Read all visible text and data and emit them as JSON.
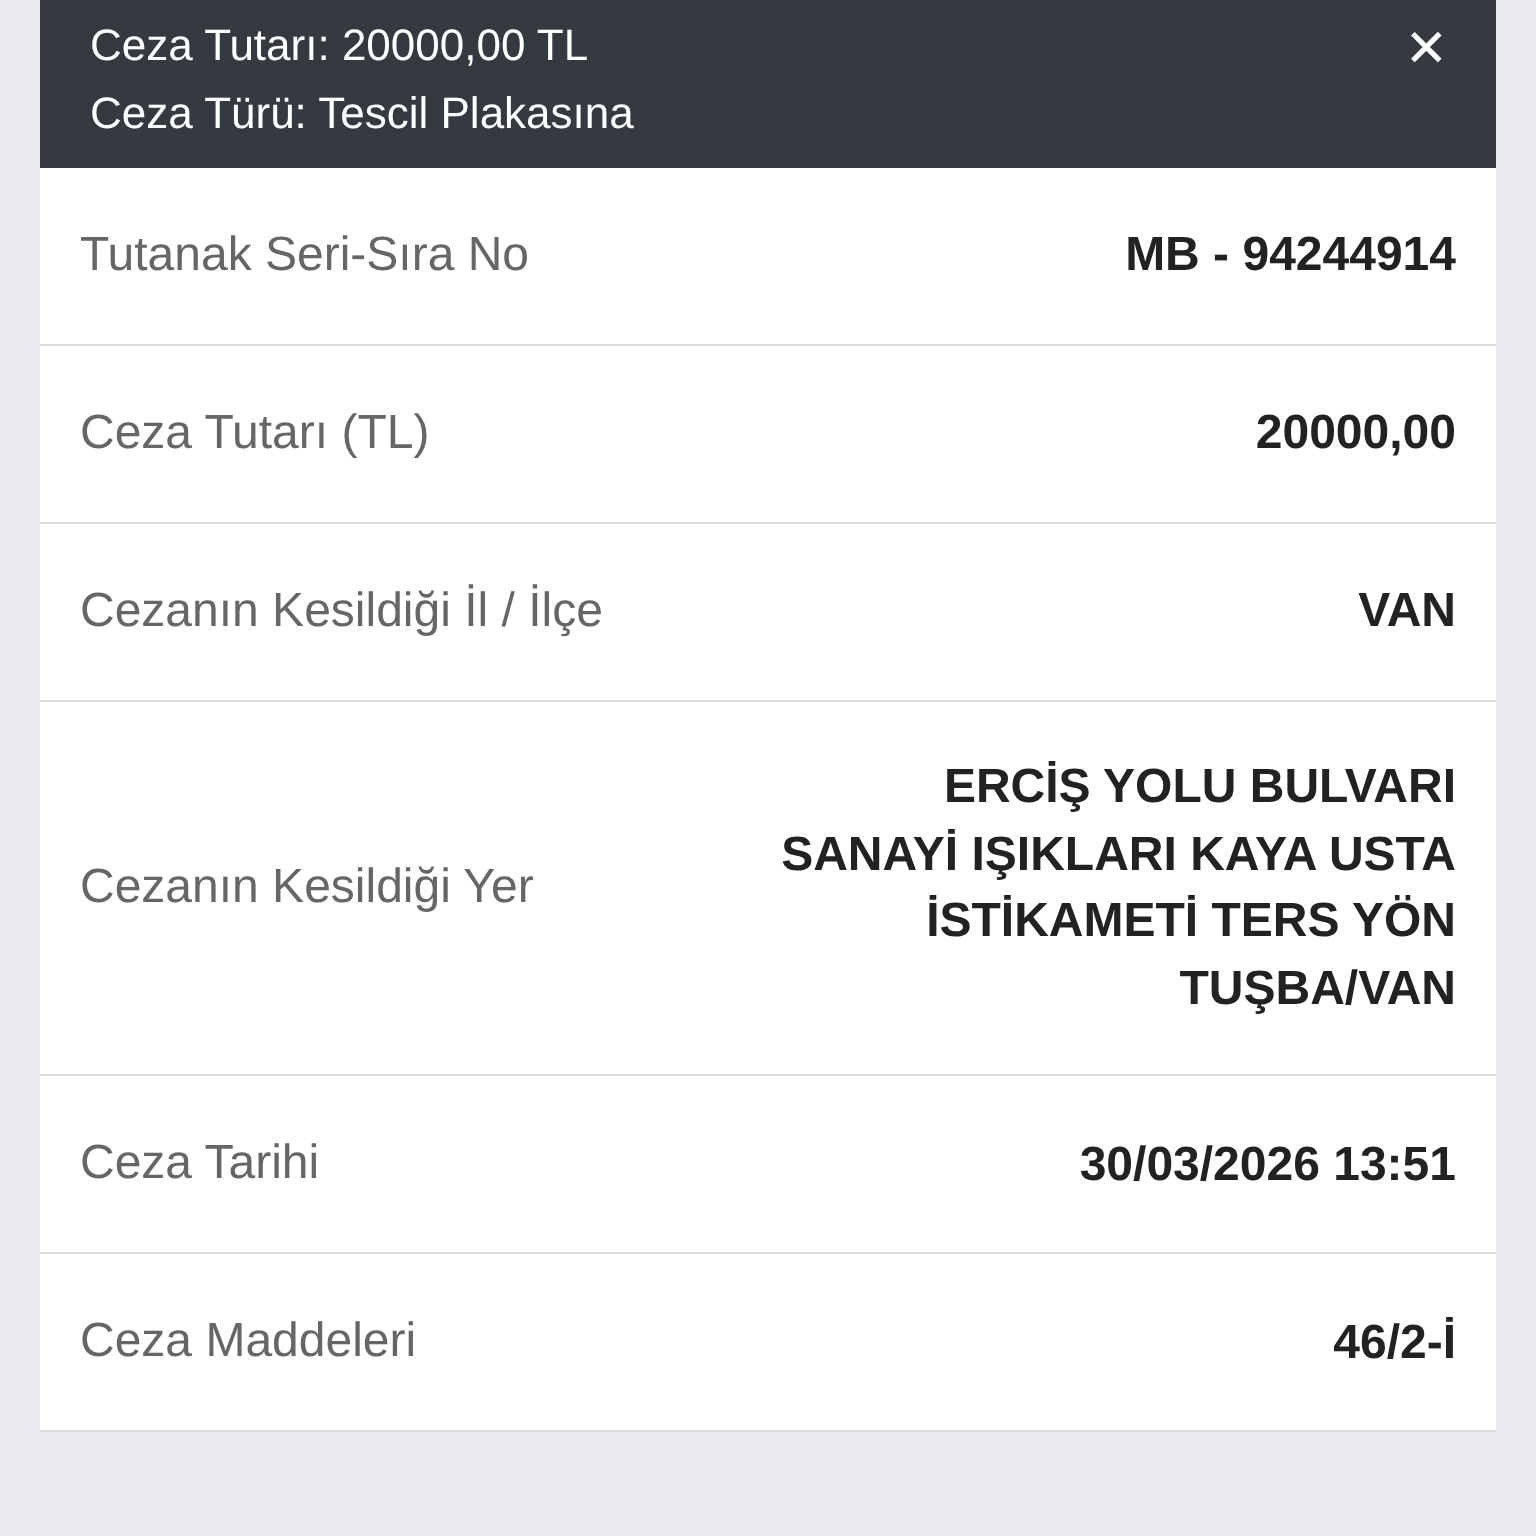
{
  "header": {
    "title": "Ceza Tutarı: 20000,00 TL",
    "subtitle": "Ceza Türü: Tescil Plakasına",
    "close": "✕"
  },
  "rows": [
    {
      "label": "Tutanak Seri-Sıra No",
      "value": "MB - 94244914"
    },
    {
      "label": "Ceza Tutarı (TL)",
      "value": "20000,00"
    },
    {
      "label": "Cezanın Kesildiği İl / İlçe",
      "value": "VAN"
    },
    {
      "label": "Cezanın Kesildiği Yer",
      "value": "ERCİŞ YOLU BULVARI SANAYİ IŞIKLARI KAYA USTA İSTİKAMETİ TERS YÖN TUŞBA/VAN"
    },
    {
      "label": "Ceza Tarihi",
      "value": "30/03/2026 13:51"
    },
    {
      "label": "Ceza Maddeleri",
      "value": "46/2-İ"
    }
  ]
}
